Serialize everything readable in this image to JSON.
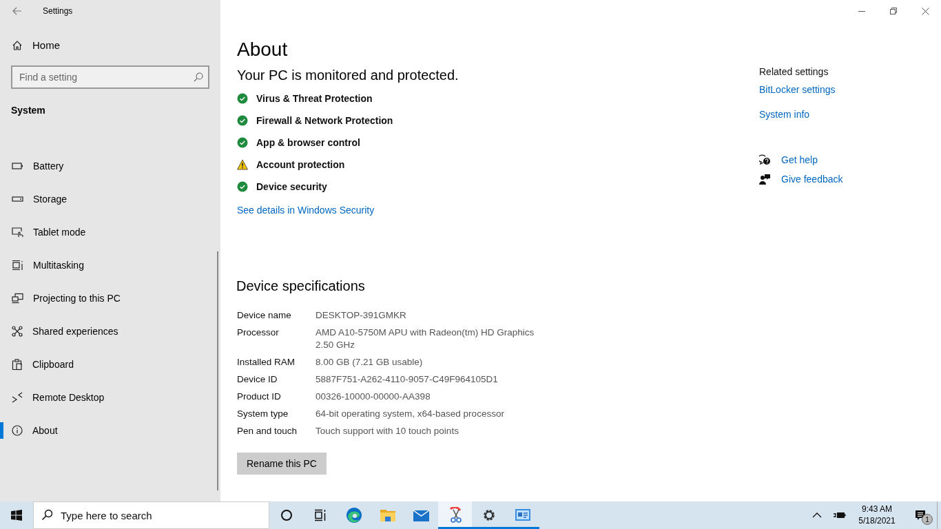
{
  "window": {
    "title": "Settings"
  },
  "sidebar": {
    "home": "Home",
    "search": {
      "placeholder": "Find a setting"
    },
    "section": "System",
    "items": [
      {
        "label": "Battery",
        "kind": "battery",
        "selected": false
      },
      {
        "label": "Storage",
        "kind": "storage",
        "selected": false
      },
      {
        "label": "Tablet mode",
        "kind": "tablet",
        "selected": false
      },
      {
        "label": "Multitasking",
        "kind": "multitask",
        "selected": false
      },
      {
        "label": "Projecting to this PC",
        "kind": "project",
        "selected": false
      },
      {
        "label": "Shared experiences",
        "kind": "shared",
        "selected": false
      },
      {
        "label": "Clipboard",
        "kind": "clipboard",
        "selected": false
      },
      {
        "label": "Remote Desktop",
        "kind": "remote",
        "selected": false
      },
      {
        "label": "About",
        "kind": "info",
        "selected": true
      }
    ]
  },
  "main": {
    "title": "About",
    "security": {
      "heading": "Your PC is monitored and protected.",
      "items": [
        {
          "label": "Virus & Threat Protection",
          "kind": "ok"
        },
        {
          "label": "Firewall & Network Protection",
          "kind": "ok"
        },
        {
          "label": "App & browser control",
          "kind": "ok"
        },
        {
          "label": "Account protection",
          "kind": "warning"
        },
        {
          "label": "Device security",
          "kind": "ok"
        }
      ],
      "link": "See details in Windows Security"
    },
    "specs": {
      "heading": "Device specifications",
      "rows": [
        {
          "label": "Device name",
          "lines": [
            "DESKTOP-391GMKR"
          ]
        },
        {
          "label": "Processor",
          "lines": [
            "AMD A10-5750M APU with Radeon(tm) HD Graphics",
            "2.50 GHz"
          ]
        },
        {
          "label": "Installed RAM",
          "lines": [
            "8.00 GB (7.21 GB usable)"
          ]
        },
        {
          "label": "Device ID",
          "lines": [
            "5887F751-A262-4110-9057-C49F964105D1"
          ]
        },
        {
          "label": "Product ID",
          "lines": [
            "00326-10000-00000-AA398"
          ]
        },
        {
          "label": "System type",
          "lines": [
            "64-bit operating system, x64-based processor"
          ]
        },
        {
          "label": "Pen and touch",
          "lines": [
            "Touch support with 10 touch points"
          ]
        }
      ],
      "button": "Rename this PC"
    }
  },
  "related": {
    "heading": "Related settings",
    "links": [
      "BitLocker settings",
      "System info"
    ],
    "help": [
      {
        "label": "Get help",
        "kind": "help"
      },
      {
        "label": "Give feedback",
        "kind": "feedback"
      }
    ]
  },
  "taskbar": {
    "search": {
      "placeholder": "Type here to search"
    },
    "apps": [
      {
        "kind": "cortana",
        "active": false,
        "selected": false
      },
      {
        "kind": "taskview",
        "active": false,
        "selected": false
      },
      {
        "kind": "edge",
        "active": false,
        "selected": false
      },
      {
        "kind": "folder",
        "active": false,
        "selected": false
      },
      {
        "kind": "mail",
        "active": false,
        "selected": false
      },
      {
        "kind": "snip",
        "active": true,
        "selected": true
      },
      {
        "kind": "settings",
        "active": true,
        "selected": false
      },
      {
        "kind": "sysinfo",
        "active": true,
        "selected": false
      }
    ],
    "time": "9:43 AM",
    "date": "5/18/2021",
    "notifications": "1"
  }
}
